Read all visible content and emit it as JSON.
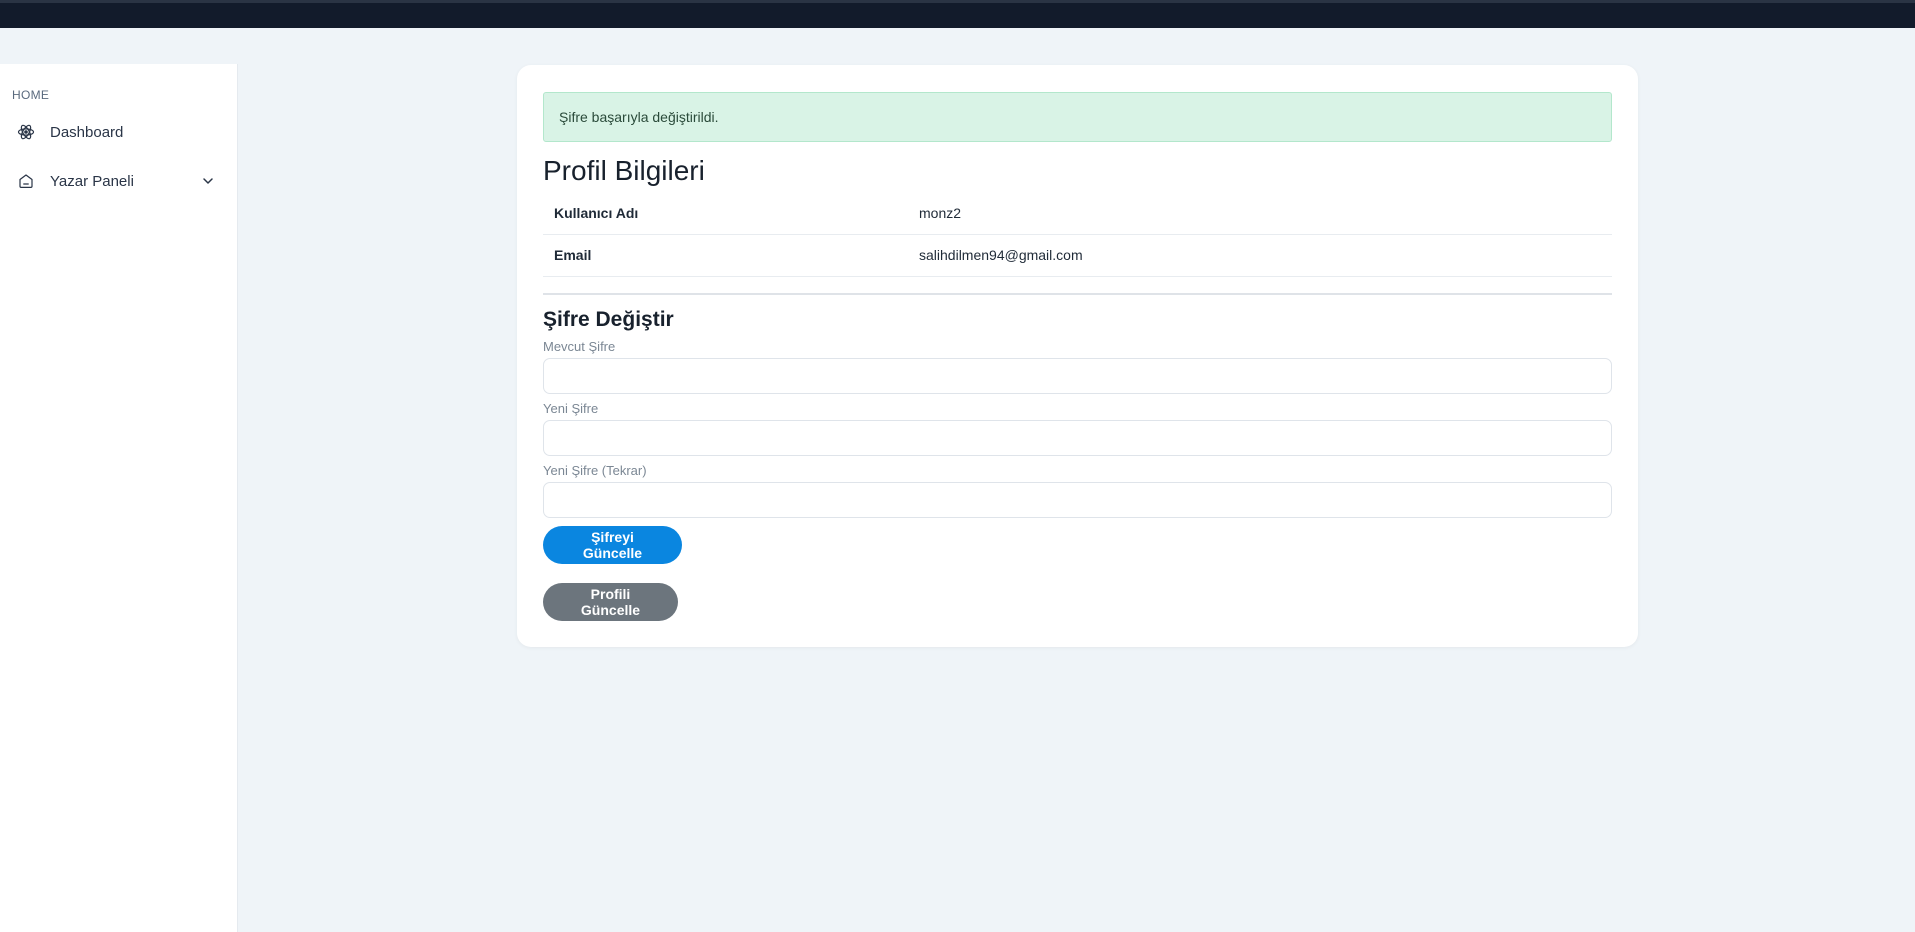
{
  "sidebar": {
    "section_label": "HOME",
    "items": [
      {
        "label": "Dashboard",
        "icon": "atom-icon"
      },
      {
        "label": "Yazar Paneli",
        "icon": "home-icon",
        "expandable": true
      }
    ]
  },
  "alert": {
    "message": "Şifre başarıyla değiştirildi.",
    "color": "#d9f3e6"
  },
  "profile": {
    "title": "Profil Bilgileri",
    "rows": [
      {
        "key": "Kullanıcı Adı",
        "value": "monz2"
      },
      {
        "key": "Email",
        "value": "salihdilmen94@gmail.com"
      }
    ]
  },
  "password_form": {
    "title": "Şifre Değiştir",
    "fields": [
      {
        "label": "Mevcut Şifre",
        "value": ""
      },
      {
        "label": "Yeni Şifre",
        "value": ""
      },
      {
        "label": "Yeni Şifre (Tekrar)",
        "value": ""
      }
    ],
    "submit_label": "Şifreyi Güncelle"
  },
  "update_profile_label": "Profili Güncelle",
  "colors": {
    "primary": "#0a86e0",
    "secondary": "#6c757d",
    "topbar": "#121b2b"
  }
}
